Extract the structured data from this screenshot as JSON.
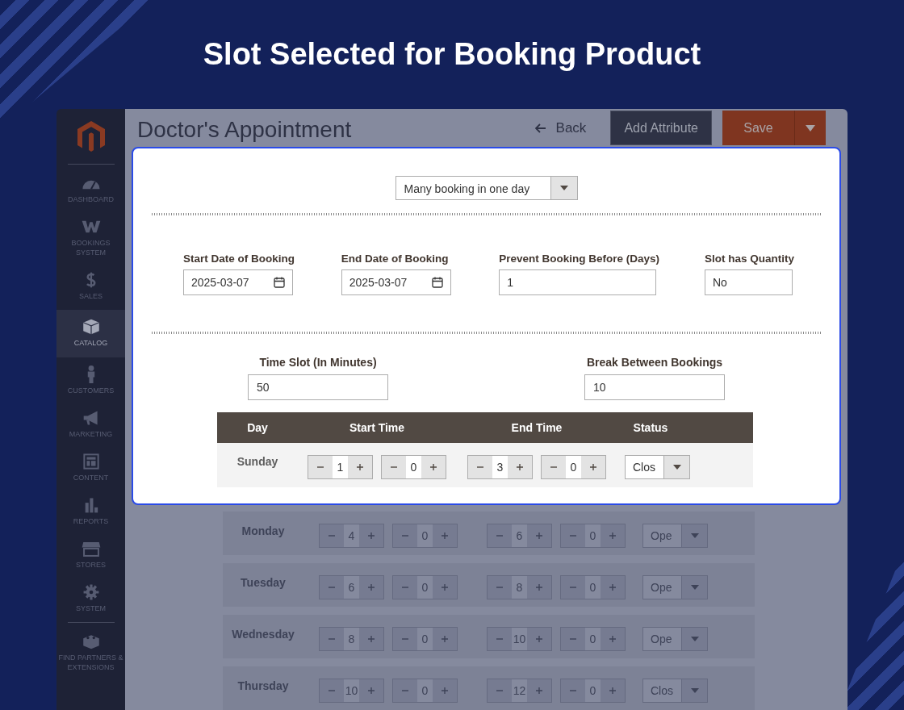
{
  "headline": "Slot Selected for Booking Product",
  "sidebar": {
    "items": [
      {
        "label": "DASHBOARD",
        "selected": false
      },
      {
        "label": "BOOKINGS SYSTEM",
        "selected": false
      },
      {
        "label": "SALES",
        "selected": false
      },
      {
        "label": "CATALOG",
        "selected": true
      },
      {
        "label": "CUSTOMERS",
        "selected": false
      },
      {
        "label": "MARKETING",
        "selected": false
      },
      {
        "label": "CONTENT",
        "selected": false
      },
      {
        "label": "REPORTS",
        "selected": false
      },
      {
        "label": "STORES",
        "selected": false
      },
      {
        "label": "SYSTEM",
        "selected": false
      },
      {
        "label": "FIND PARTNERS & EXTENSIONS",
        "selected": false
      }
    ]
  },
  "header": {
    "title": "Doctor's Appointment",
    "back": "Back",
    "add_attribute": "Add Attribute",
    "save": "Save"
  },
  "popup": {
    "booking_type": "Many booking in one day",
    "fields": [
      {
        "label": "Start Date of Booking",
        "value": "2025-03-07",
        "kind": "date"
      },
      {
        "label": "End Date of Booking",
        "value": "2025-03-07",
        "kind": "date"
      },
      {
        "label": "Prevent Booking Before (Days)",
        "value": "1",
        "kind": "text"
      },
      {
        "label": "Slot has Quantity",
        "value": "No",
        "kind": "text"
      }
    ],
    "time_fields": [
      {
        "label": "Time Slot (In Minutes)",
        "value": "50"
      },
      {
        "label": "Break Between Bookings",
        "value": "10"
      }
    ],
    "table": {
      "columns": [
        "Day",
        "Start Time",
        "End Time",
        "Status"
      ],
      "rows": [
        {
          "day": "Sunday",
          "start": [
            "1",
            "0"
          ],
          "end": [
            "3",
            "0"
          ],
          "status": "Clos"
        }
      ]
    }
  },
  "page_rows": [
    {
      "day": "Monday",
      "start": [
        "4",
        "0"
      ],
      "end": [
        "6",
        "0"
      ],
      "status": "Ope"
    },
    {
      "day": "Tuesday",
      "start": [
        "6",
        "0"
      ],
      "end": [
        "8",
        "0"
      ],
      "status": "Ope"
    },
    {
      "day": "Wednesday",
      "start": [
        "8",
        "0"
      ],
      "end": [
        "10",
        "0"
      ],
      "status": "Ope"
    },
    {
      "day": "Thursday",
      "start": [
        "10",
        "0"
      ],
      "end": [
        "12",
        "0"
      ],
      "status": "Clos"
    }
  ]
}
